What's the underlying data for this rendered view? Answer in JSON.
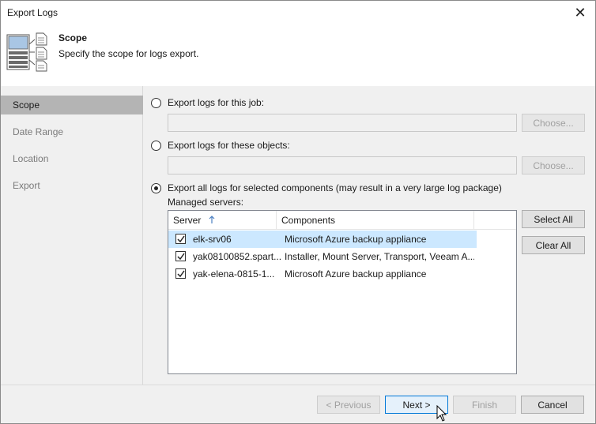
{
  "window": {
    "title": "Export Logs"
  },
  "header": {
    "title": "Scope",
    "subtitle": "Specify the scope for logs export."
  },
  "sidebar": {
    "items": [
      {
        "label": "Scope",
        "active": true
      },
      {
        "label": "Date Range",
        "active": false
      },
      {
        "label": "Location",
        "active": false
      },
      {
        "label": "Export",
        "active": false
      }
    ]
  },
  "options": {
    "job": {
      "label": "Export logs for this job:",
      "value": "",
      "button": "Choose..."
    },
    "objects": {
      "label": "Export logs for these objects:",
      "value": "",
      "button": "Choose..."
    },
    "components": {
      "label": "Export all logs for selected components (may result in a very large log package)"
    }
  },
  "servers": {
    "label": "Managed servers:",
    "columns": {
      "server": "Server",
      "server_sort_icon": "arrow-up",
      "components": "Components"
    },
    "rows": [
      {
        "server": "elk-srv06",
        "components": "Microsoft Azure backup appliance",
        "checked": true
      },
      {
        "server": "yak08100852.spart...",
        "components": "Installer, Mount Server, Transport, Veeam A...",
        "checked": true
      },
      {
        "server": "yak-elena-0815-1...",
        "components": "Microsoft Azure backup appliance",
        "checked": true
      }
    ],
    "select_all": "Select All",
    "clear_all": "Clear All"
  },
  "footer": {
    "previous": "< Previous",
    "next": "Next >",
    "finish": "Finish",
    "cancel": "Cancel"
  }
}
